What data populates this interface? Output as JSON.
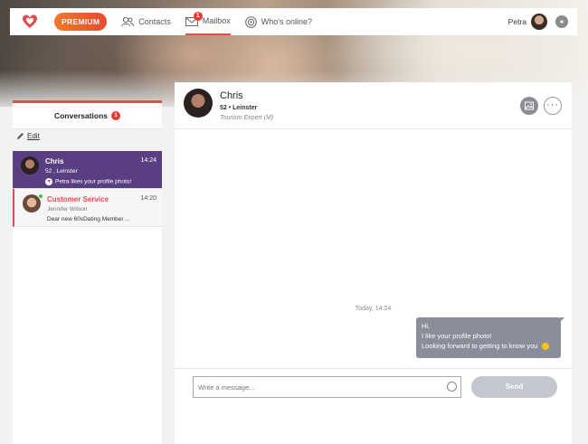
{
  "nav": {
    "premium": "PREMIUM",
    "contacts": "Contacts",
    "mailbox": "Mailbox",
    "mailbox_badge": "1",
    "whos_online": "Who's online?",
    "user_name": "Petra"
  },
  "sidebar": {
    "tab_label": "Conversations",
    "tab_count": "1",
    "edit_label": "Edit",
    "conversations": [
      {
        "name": "Chris",
        "time": "14:24",
        "sub": "52 , Leinster",
        "message": "Petra likes your profile photo!"
      },
      {
        "name": "Customer Service",
        "time": "14:20",
        "sub": "Jennifer Wilson",
        "message": "Dear new 60sDating Member ..."
      }
    ]
  },
  "chat": {
    "name": "Chris",
    "subtitle": "52 • Leinster",
    "job": "Tourism Expert (M)",
    "more": "···",
    "day_label": "Today, 14:24",
    "bubble_lines": [
      "Hi,",
      "I like your profile photo!",
      "Looking forward to getting to know you"
    ],
    "input_placeholder": "Write a message...",
    "send_label": "Send"
  },
  "colors": {
    "accent": "#e84b4b",
    "selected": "#5a3e82",
    "bubble": "#8a8e9a",
    "premium_start": "#f07a2a",
    "premium_end": "#e84b2e"
  }
}
